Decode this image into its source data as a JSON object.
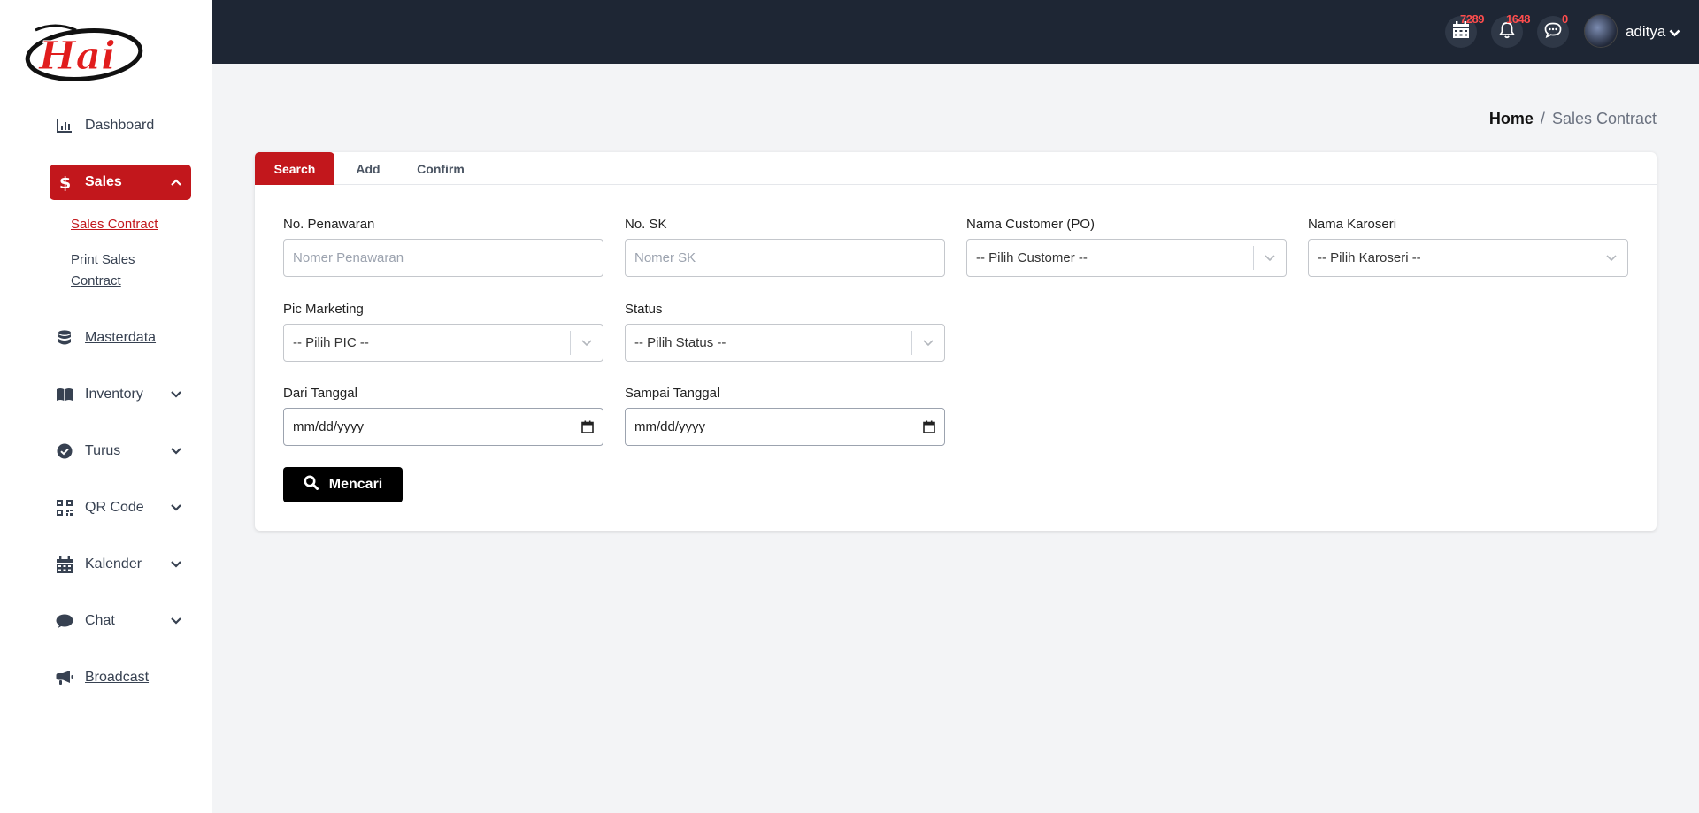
{
  "sidebar": {
    "logo_text": "Hai",
    "items": [
      {
        "label": "Dashboard",
        "icon": "bar-chart-icon"
      },
      {
        "label": "Sales",
        "icon": "dollar-icon",
        "expanded": true,
        "active": true
      },
      {
        "label": "Masterdata",
        "icon": "database-icon"
      },
      {
        "label": "Inventory",
        "icon": "book-icon"
      },
      {
        "label": "Turus",
        "icon": "check-circle-icon"
      },
      {
        "label": "QR Code",
        "icon": "qr-code-icon"
      },
      {
        "label": "Kalender",
        "icon": "calendar-icon"
      },
      {
        "label": "Chat",
        "icon": "chat-bubble-icon"
      },
      {
        "label": "Broadcast",
        "icon": "megaphone-icon"
      }
    ],
    "sales_sub": [
      {
        "label": "Sales Contract",
        "active": true
      },
      {
        "label": "Print Sales Contract"
      }
    ]
  },
  "topbar": {
    "calendar_badge": "7289",
    "notification_badge": "1648",
    "message_badge": "0",
    "user_name": "aditya"
  },
  "breadcrumb": {
    "home": "Home",
    "separator": "/",
    "current": "Sales Contract"
  },
  "tabs": [
    {
      "label": "Search",
      "active": true
    },
    {
      "label": "Add"
    },
    {
      "label": "Confirm"
    }
  ],
  "form": {
    "no_penawaran": {
      "label": "No. Penawaran",
      "placeholder": "Nomer Penawaran"
    },
    "no_sk": {
      "label": "No. SK",
      "placeholder": "Nomer SK"
    },
    "nama_customer": {
      "label": "Nama Customer (PO)",
      "value": "-- Pilih Customer --"
    },
    "nama_karoseri": {
      "label": "Nama Karoseri",
      "value": "-- Pilih Karoseri --"
    },
    "pic_marketing": {
      "label": "Pic Marketing",
      "value": "-- Pilih PIC --"
    },
    "status": {
      "label": "Status",
      "value": "-- Pilih Status --"
    },
    "dari_tanggal": {
      "label": "Dari Tanggal",
      "value": "mm/dd/yyyy"
    },
    "sampai_tanggal": {
      "label": "Sampai Tanggal",
      "value": "mm/dd/yyyy"
    },
    "search_button": "Mencari"
  },
  "colors": {
    "accent": "#c2171c",
    "topbar": "#1e2634",
    "background": "#f3f4f6"
  }
}
